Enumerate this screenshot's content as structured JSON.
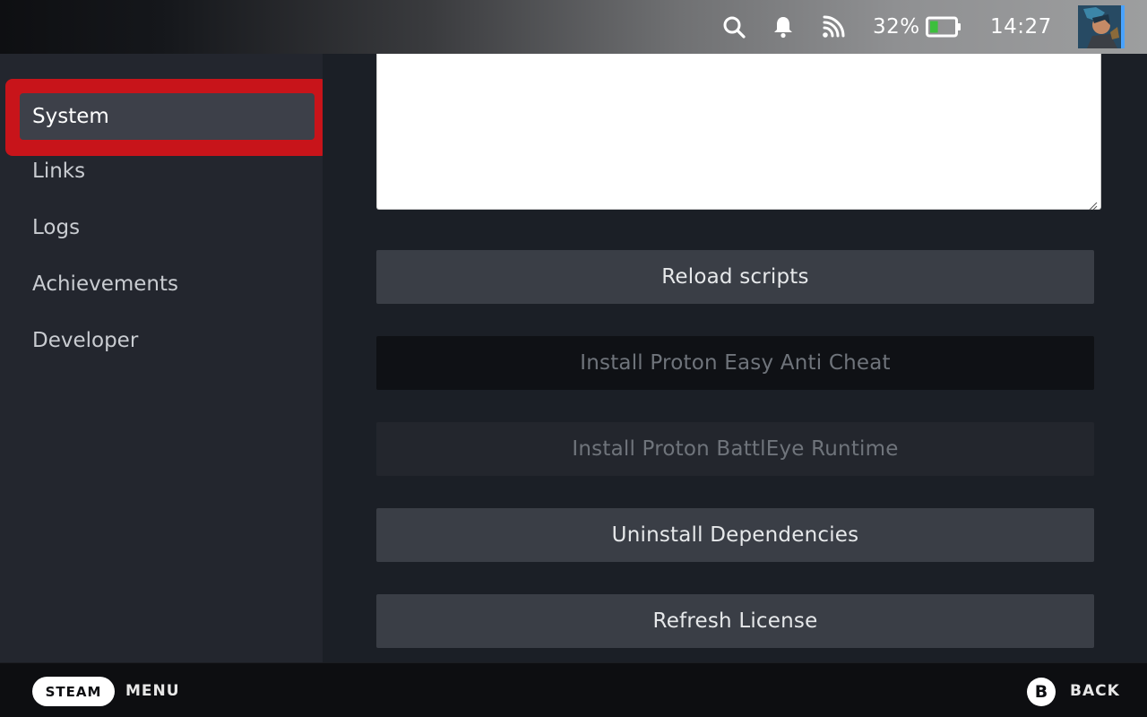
{
  "status_bar": {
    "battery_percent": "32%",
    "battery_level": 0.32,
    "time": "14:27",
    "icons": [
      "search-icon",
      "bell-icon",
      "wifi-icon",
      "battery-icon"
    ],
    "accent_color": "#4aa3ff"
  },
  "sidebar": {
    "items": [
      {
        "label": "System",
        "active": true
      },
      {
        "label": "Links"
      },
      {
        "label": "Logs"
      },
      {
        "label": "Achievements"
      },
      {
        "label": "Developer"
      }
    ],
    "highlight_color": "#c8141a"
  },
  "main": {
    "textarea_value": "",
    "buttons": [
      {
        "label": "Reload scripts",
        "state": "enabled"
      },
      {
        "label": "Install Proton Easy Anti Cheat",
        "state": "disabled"
      },
      {
        "label": "Install Proton BattlEye Runtime",
        "state": "disabled"
      },
      {
        "label": "Uninstall Dependencies",
        "state": "enabled"
      },
      {
        "label": "Refresh License",
        "state": "enabled"
      }
    ]
  },
  "footer": {
    "steam_label": "STEAM",
    "menu_label": "MENU",
    "b_button": "B",
    "back_label": "BACK"
  }
}
